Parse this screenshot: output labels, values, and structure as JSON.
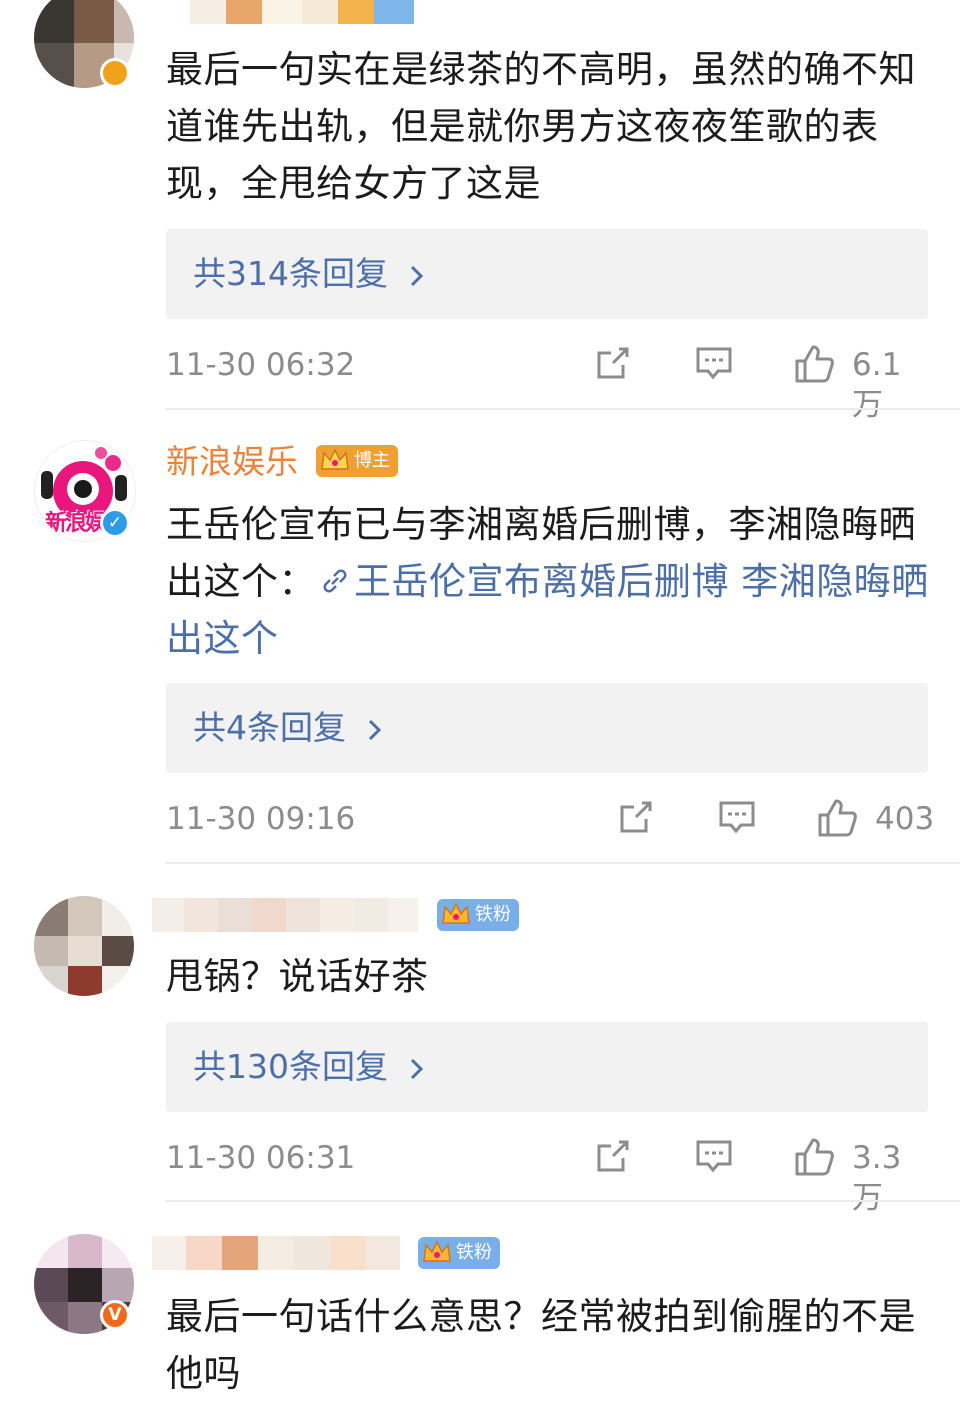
{
  "comments": [
    {
      "text": "最后一句实在是绿茶的不高明，虽然的确不知道谁先出轨，但是就你男方这夜夜笙歌的表现，全甩给女方了这是",
      "replies": "共314条回复",
      "time": "11-30 06:32",
      "likes": "6.1万"
    },
    {
      "username": "新浪娱乐",
      "badge": "博主",
      "avatar_text": "新浪娱",
      "text_plain": "王岳伦宣布已与李湘离婚后删博，李湘隐晦晒出这个：",
      "text_link": "王岳伦宣布离婚后删博 李湘隐晦晒出这个",
      "replies": "共4条回复",
      "time": "11-30 09:16",
      "likes": "403"
    },
    {
      "badge": "铁粉",
      "text": "甩锅？说话好茶",
      "replies": "共130条回复",
      "time": "11-30 06:31",
      "likes": "3.3万"
    },
    {
      "badge": "铁粉",
      "text": "最后一句话什么意思？经常被拍到偷腥的不是他吗"
    }
  ],
  "icons": {
    "share": "share-icon",
    "comment": "comment-icon",
    "like": "like-icon",
    "chevron": "chevron-right-icon",
    "link": "link-icon",
    "verified": "verified-icon",
    "crown": "crown-icon"
  },
  "colors": {
    "link_blue": "#4d6fa8",
    "username_orange": "#e8843c",
    "meta_gray": "#8c8c8c",
    "reply_bg": "#f2f2f2",
    "verified_blue": "#2d9be8",
    "verified_orange": "#f06a1b",
    "fan_badge_blue": "#7aaee8",
    "blogger_badge_orange": "#f0a030"
  }
}
